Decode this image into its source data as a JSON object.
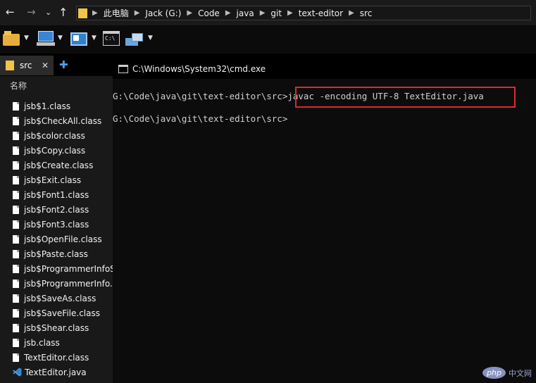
{
  "breadcrumb": [
    "此电脑",
    "Jack (G:)",
    "Code",
    "java",
    "git",
    "text-editor",
    "src"
  ],
  "tab": {
    "label": "src",
    "close": "✕",
    "add": "✚"
  },
  "sidebar": {
    "header": "名称",
    "items": [
      {
        "name": "jsb$1.class",
        "icon": "file-icon"
      },
      {
        "name": "jsb$CheckAll.class",
        "icon": "file-icon"
      },
      {
        "name": "jsb$color.class",
        "icon": "file-icon"
      },
      {
        "name": "jsb$Copy.class",
        "icon": "file-icon"
      },
      {
        "name": "jsb$Create.class",
        "icon": "file-icon"
      },
      {
        "name": "jsb$Exit.class",
        "icon": "file-icon"
      },
      {
        "name": "jsb$Font1.class",
        "icon": "file-icon"
      },
      {
        "name": "jsb$Font2.class",
        "icon": "file-icon"
      },
      {
        "name": "jsb$Font3.class",
        "icon": "file-icon"
      },
      {
        "name": "jsb$OpenFile.class",
        "icon": "file-icon"
      },
      {
        "name": "jsb$Paste.class",
        "icon": "file-icon"
      },
      {
        "name": "jsb$ProgrammerInfoS",
        "icon": "file-icon"
      },
      {
        "name": "jsb$ProgrammerInfo.",
        "icon": "file-icon"
      },
      {
        "name": "jsb$SaveAs.class",
        "icon": "file-icon"
      },
      {
        "name": "jsb$SaveFile.class",
        "icon": "file-icon"
      },
      {
        "name": "jsb$Shear.class",
        "icon": "file-icon"
      },
      {
        "name": "jsb.class",
        "icon": "file-icon"
      },
      {
        "name": "TextEditor.class",
        "icon": "file-icon"
      },
      {
        "name": "TextEditor.java",
        "icon": "vscode-icon"
      }
    ]
  },
  "cmd": {
    "title": "C:\\Windows\\System32\\cmd.exe",
    "lines": [
      {
        "prompt": "G:\\Code\\java\\git\\text-editor\\src>",
        "command": "javac -encoding UTF-8 TextEditor.java"
      },
      {
        "prompt": "G:\\Code\\java\\git\\text-editor\\src>",
        "command": ""
      }
    ]
  },
  "watermark": {
    "brand": "php",
    "site": "中文网"
  },
  "colors": {
    "highlight": "#e0282a",
    "folder": "#f1c34d",
    "vscode": "#2f8ad8",
    "watermark": "#8892bf"
  }
}
